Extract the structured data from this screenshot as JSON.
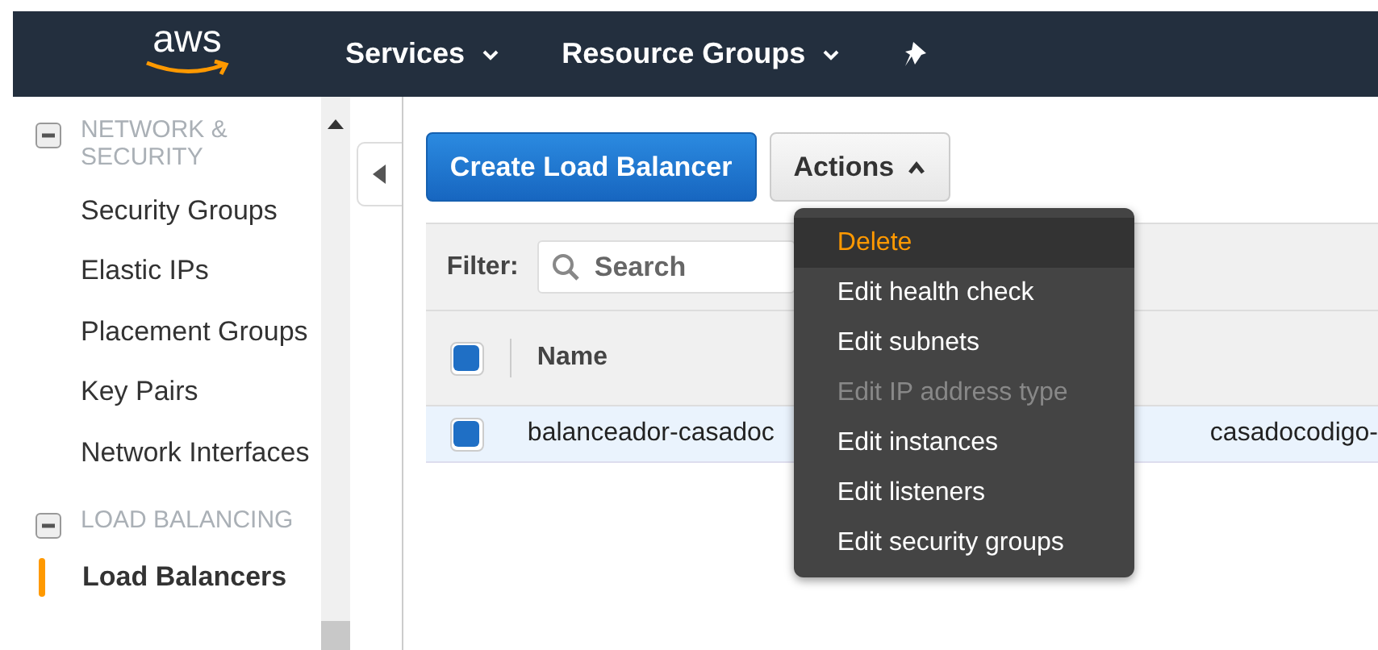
{
  "top_nav": {
    "logo": "aws",
    "menus": [
      {
        "label": "Services"
      },
      {
        "label": "Resource Groups"
      }
    ]
  },
  "sidebar": {
    "groups": [
      {
        "title": "NETWORK & SECURITY",
        "expanded": true,
        "items": [
          {
            "label": "Security Groups",
            "selected": false
          },
          {
            "label": "Elastic IPs",
            "selected": false
          },
          {
            "label": "Placement Groups",
            "selected": false
          },
          {
            "label": "Key Pairs",
            "selected": false
          },
          {
            "label": "Network Interfaces",
            "selected": false
          }
        ]
      },
      {
        "title": "LOAD BALANCING",
        "expanded": true,
        "items": [
          {
            "label": "Load Balancers",
            "selected": true
          }
        ]
      }
    ]
  },
  "toolbar": {
    "primary_button": "Create Load Balancer",
    "actions_button": "Actions",
    "actions_expanded": true
  },
  "filter": {
    "label": "Filter:",
    "placeholder": "Search"
  },
  "table": {
    "header_checked": true,
    "columns": [
      "Name"
    ],
    "rows": [
      {
        "checked": true,
        "name": "balanceador-casadoc",
        "column_2": "casadocodigo-"
      }
    ]
  },
  "actions_menu": [
    {
      "label": "Delete",
      "highlighted": true,
      "disabled": false
    },
    {
      "label": "Edit health check",
      "highlighted": false,
      "disabled": false
    },
    {
      "label": "Edit subnets",
      "highlighted": false,
      "disabled": false
    },
    {
      "label": "Edit IP address type",
      "highlighted": false,
      "disabled": true
    },
    {
      "label": "Edit instances",
      "highlighted": false,
      "disabled": false
    },
    {
      "label": "Edit listeners",
      "highlighted": false,
      "disabled": false
    },
    {
      "label": "Edit security groups",
      "highlighted": false,
      "disabled": false
    }
  ]
}
